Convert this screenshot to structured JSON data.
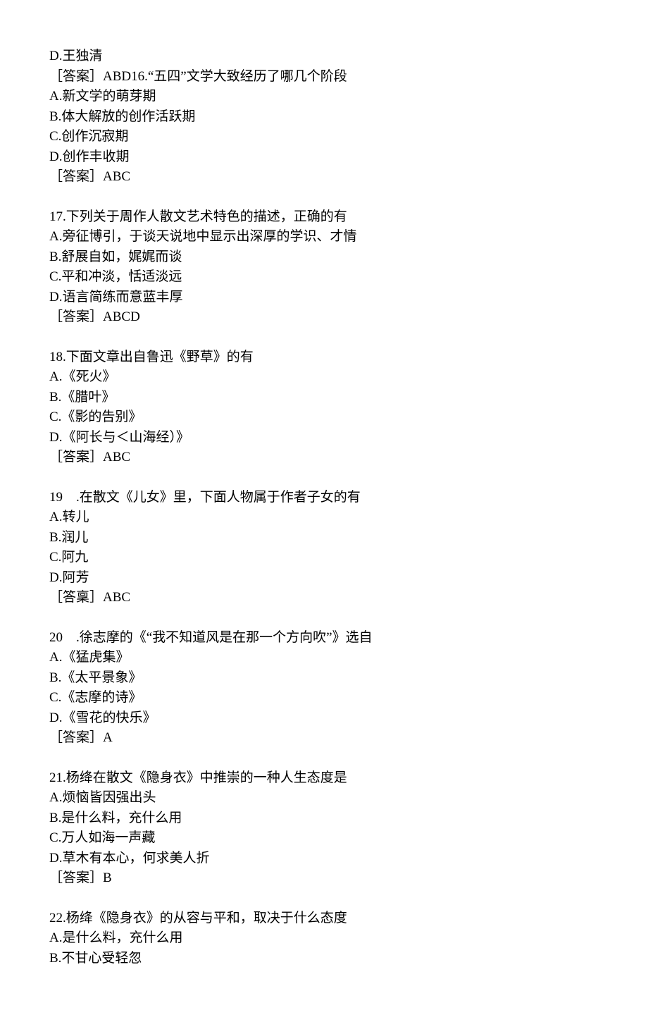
{
  "blocks": [
    {
      "lines": [
        "D.王独清",
        "［答案］ABD16.“五四”文学大致经历了哪几个阶段",
        "A.新文学的萌芽期",
        "B.体大解放的创作活跃期",
        "C.创作沉寂期",
        "D.创作丰收期",
        "［答案］ABC"
      ]
    },
    {
      "lines": [
        "17.下列关于周作人散文艺术特色的描述，正确的有",
        "A.旁征博引，于谈天说地中显示出深厚的学识、才情",
        "B.舒展自如，娓娓而谈",
        "C.平和冲淡，恬适淡远",
        "D.语言简练而意蓝丰厚",
        "［答案］ABCD"
      ]
    },
    {
      "lines": [
        "18.下面文章出自鲁迅《野草》的有",
        "A.《死火》",
        "B.《腊叶》",
        "C.《影的告别》",
        "D.《阿长与＜山海经）》",
        "［答案］ABC"
      ]
    },
    {
      "lines": [
        "19　.在散文《儿女》里，下面人物属于作者子女的有",
        "A.转儿",
        "B.润儿",
        "C.阿九",
        "D.阿芳",
        "［答稟］ABC"
      ]
    },
    {
      "lines": [
        "20　.徐志摩的《“我不知道风是在那一个方向吹”》选自",
        "A.《猛虎集》",
        "B.《太平景象》",
        "C.《志摩的诗》",
        "D.《雪花的快乐》",
        "［答案］A"
      ]
    },
    {
      "lines": [
        "21.杨绛在散文《隐身衣》中推崇的一种人生态度是",
        "A.烦恼皆因强出头",
        "B.是什么料，充什么用",
        "C.万人如海一声藏",
        "D.草木有本心，何求美人折",
        "［答案］B"
      ]
    },
    {
      "lines": [
        "22.杨绛《隐身衣》的从容与平和，取决于什么态度",
        "A.是什么料，充什么用",
        "B.不甘心受轻忽"
      ]
    }
  ]
}
